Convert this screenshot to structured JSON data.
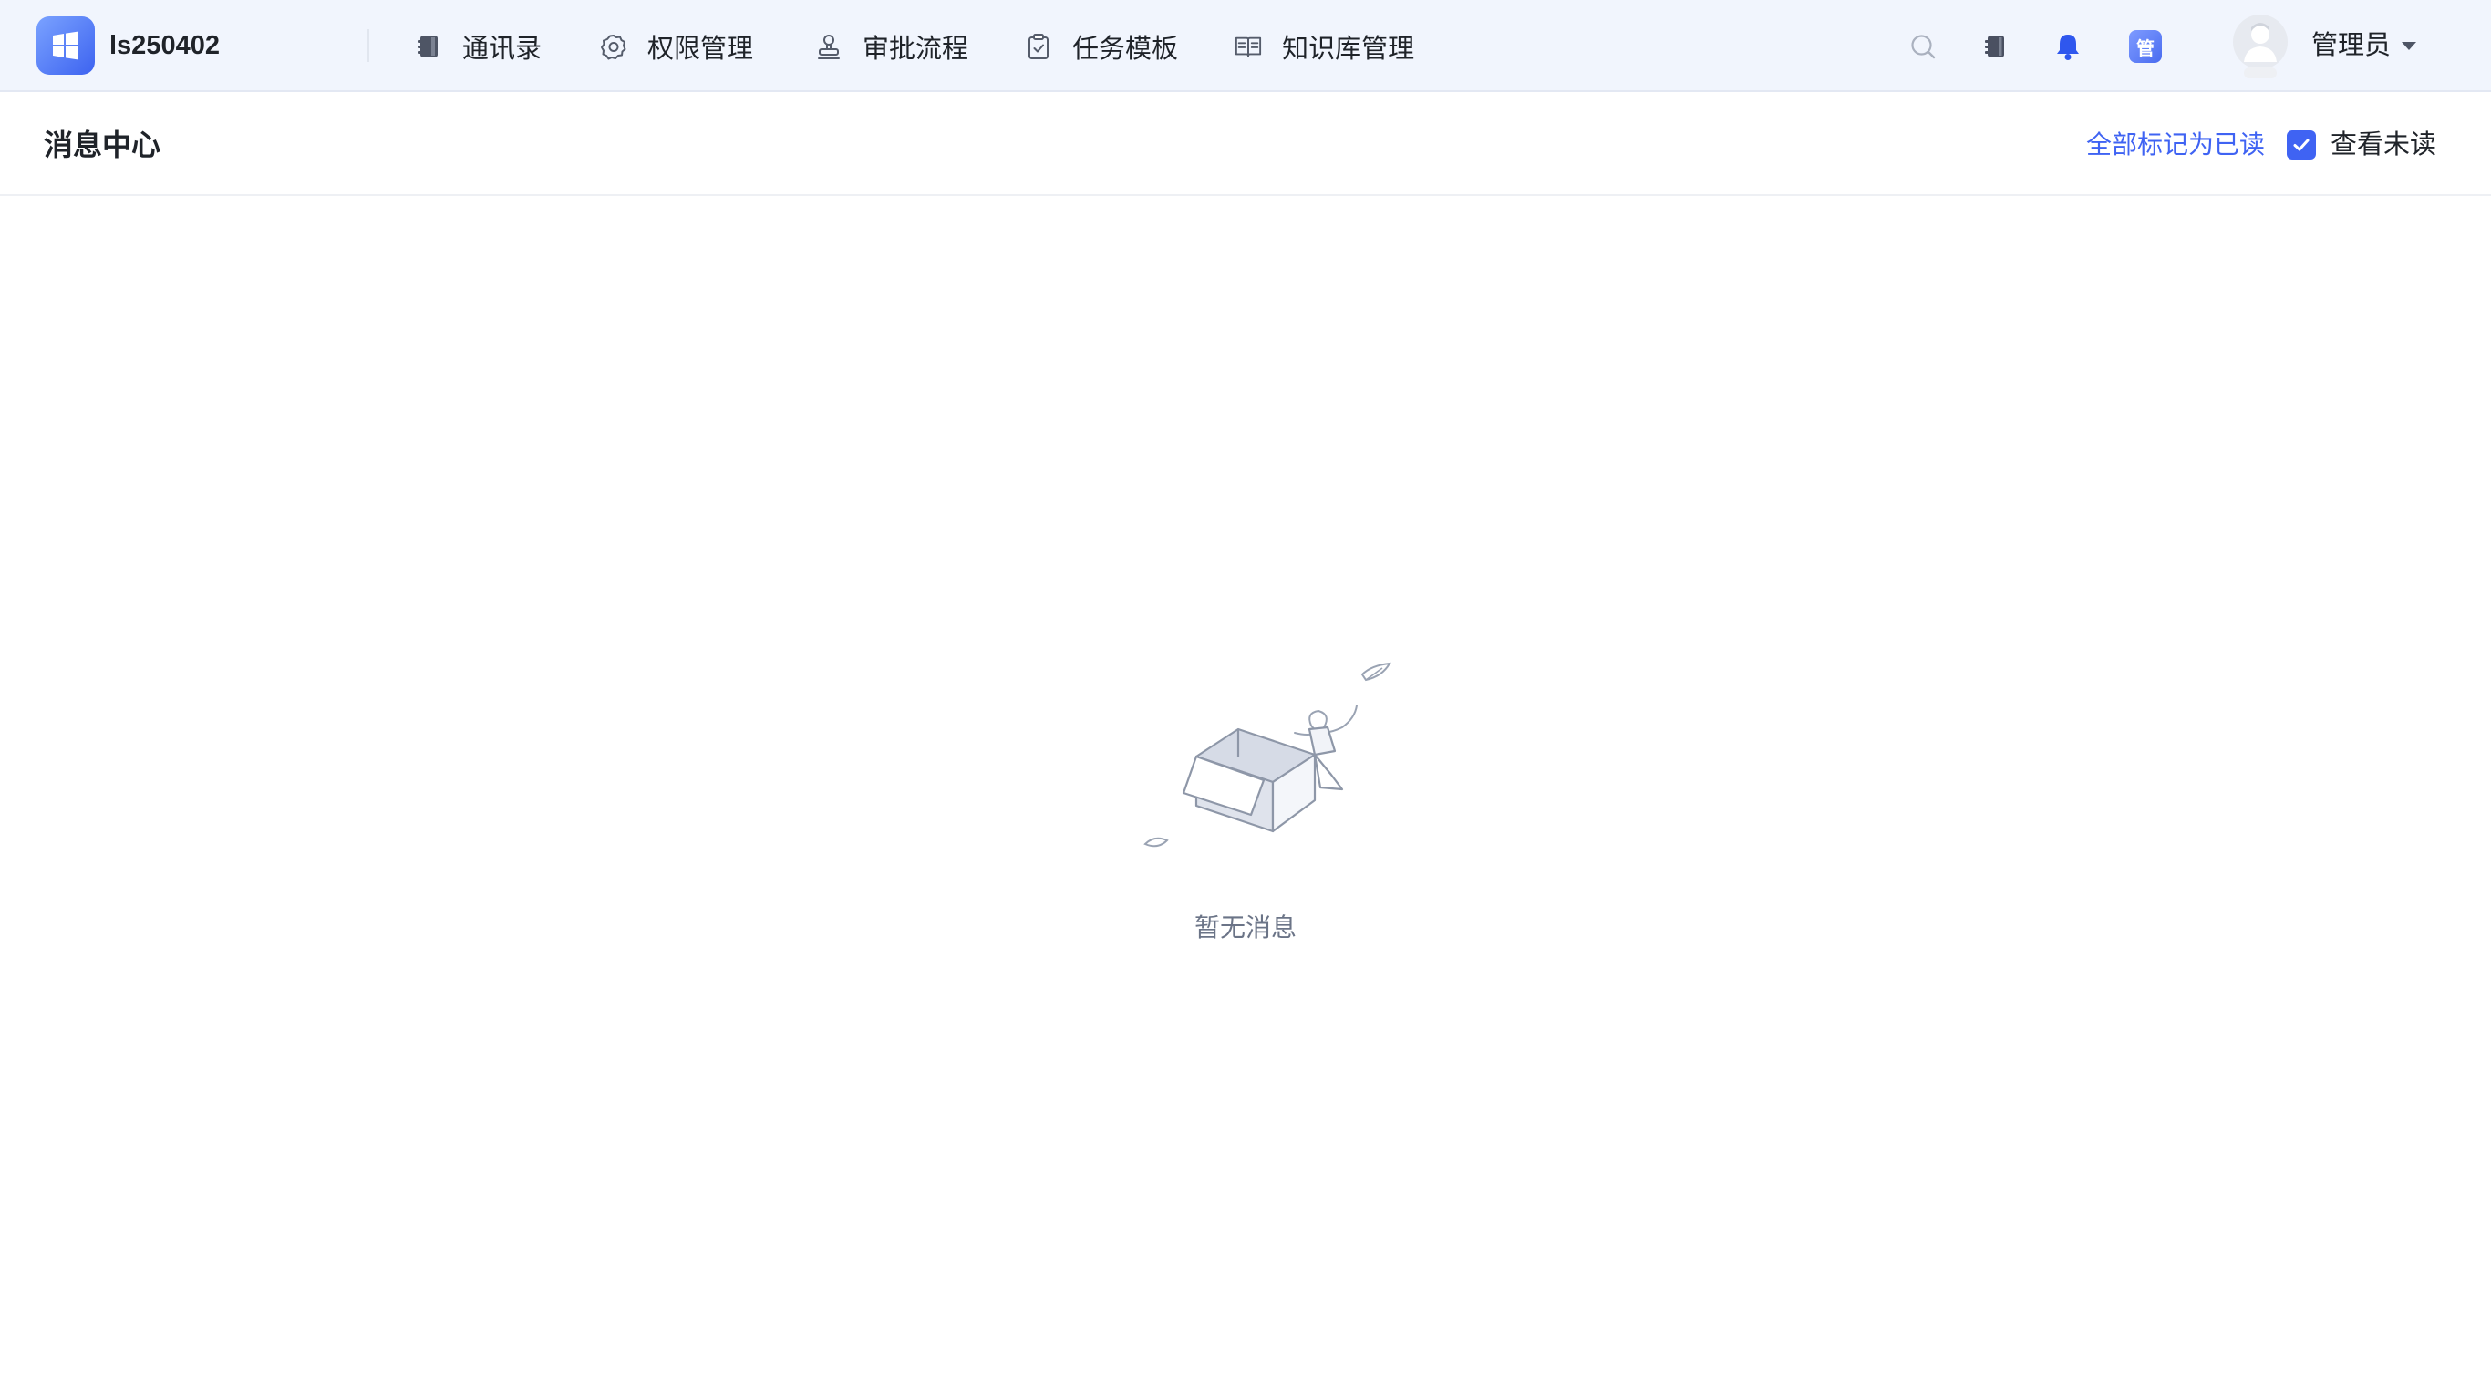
{
  "app": {
    "org_name": "ls250402"
  },
  "nav": {
    "items": [
      {
        "label": "通讯录",
        "icon": "contacts-book-icon"
      },
      {
        "label": "权限管理",
        "icon": "gear-icon"
      },
      {
        "label": "审批流程",
        "icon": "stamp-icon"
      },
      {
        "label": "任务模板",
        "icon": "clipboard-check-icon"
      },
      {
        "label": "知识库管理",
        "icon": "open-book-icon"
      }
    ]
  },
  "toolbar": {
    "icons": [
      "search-icon",
      "contacts-book-icon",
      "bell-icon"
    ],
    "badge_label": "管"
  },
  "user": {
    "name": "管理员"
  },
  "page": {
    "title": "消息中心",
    "mark_all_read": "全部标记为已读",
    "unread_filter_label": "查看未读",
    "unread_filter_checked": true,
    "empty_text": "暂无消息"
  },
  "colors": {
    "accent": "#3f63f3",
    "topbar_bg": "#f1f5fd",
    "text": "#1f2329",
    "muted": "#6b7487",
    "bell": "#2f57ee"
  }
}
